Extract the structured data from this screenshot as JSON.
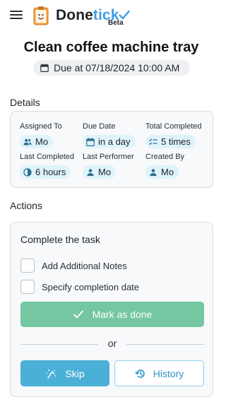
{
  "header": {
    "brand_part1": "Done",
    "brand_part2": "tick",
    "beta": "Beta",
    "menu_icon": "hamburger-menu-icon",
    "logo_icon": "clipboard-face-icon",
    "accent_color": "#3f9fe0"
  },
  "task": {
    "title": "Clean coffee machine tray",
    "due": "Due at 07/18/2024 10:00 AM"
  },
  "details": {
    "heading": "Details",
    "fields": [
      {
        "label": "Assigned To",
        "value": "Mo",
        "icon": "group-icon"
      },
      {
        "label": "Due Date",
        "value": "in a day",
        "icon": "calendar-icon"
      },
      {
        "label": "Total Completed",
        "value": "5 times",
        "icon": "checklist-icon"
      },
      {
        "label": "Last Completed",
        "value": "6 hours",
        "icon": "clock-icon"
      },
      {
        "label": "Last Performer",
        "value": "Mo",
        "icon": "person-icon"
      },
      {
        "label": "Created By",
        "value": "Mo",
        "icon": "person-icon"
      }
    ]
  },
  "actions": {
    "heading": "Actions",
    "complete_title": "Complete the task",
    "notes_label": "Add Additional Notes",
    "date_label": "Specify completion date",
    "mark_done_label": "Mark as done",
    "or_label": "or",
    "skip_label": "Skip",
    "history_label": "History",
    "colors": {
      "mark_done": "#74c7a0",
      "skip": "#4ab0d6",
      "history_text": "#2d96c4"
    }
  }
}
